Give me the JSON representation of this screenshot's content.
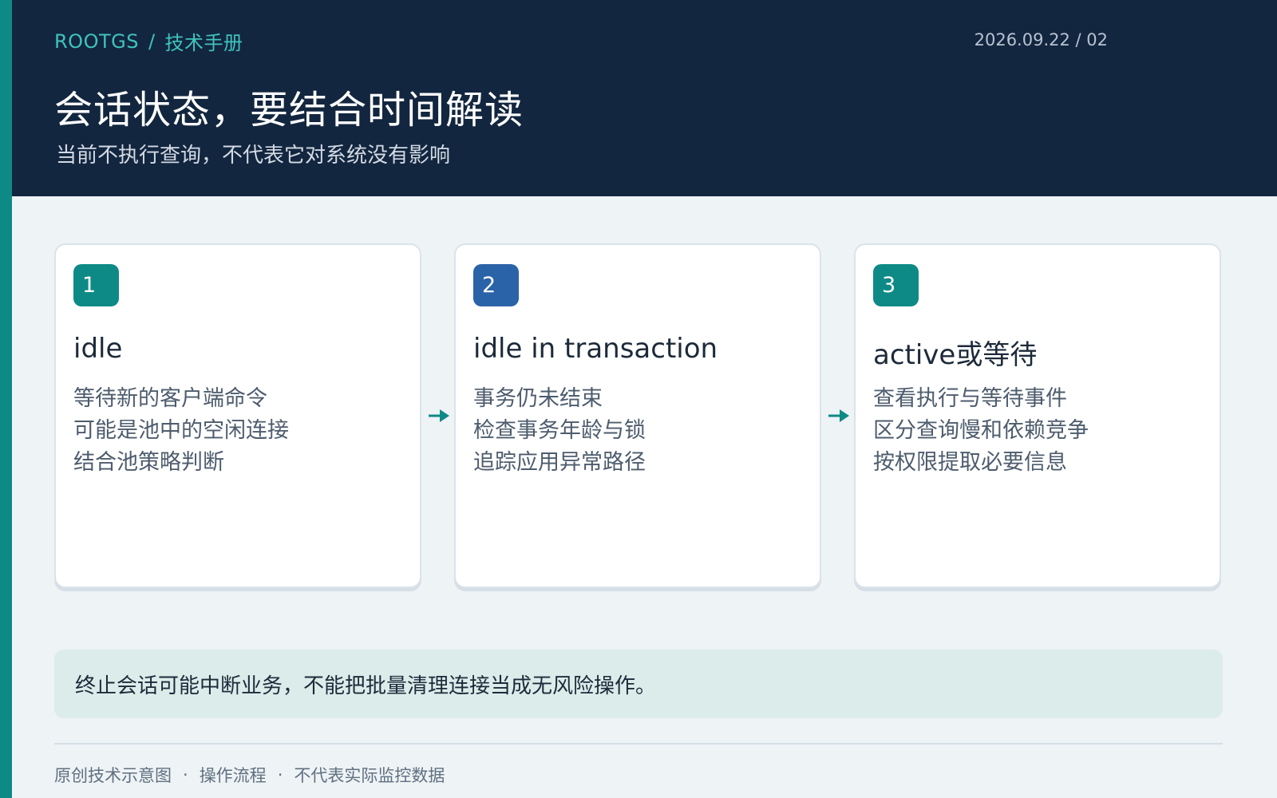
{
  "colors": {
    "accent": "#0e8a86",
    "header_bg": "#13263f",
    "badge_teal": "#0e8a86",
    "badge_blue": "#2b63a8",
    "notice_bg": "#dcecea"
  },
  "header": {
    "brand": "ROOTGS",
    "separator": "/",
    "section": "技术手册",
    "meta": "2026.09.22 / 02",
    "title": "会话状态，要结合时间解读",
    "subtitle": "当前不执行查询，不代表它对系统没有影响"
  },
  "cards": [
    {
      "step": "1",
      "badge_color": "#0e8a86",
      "title": "idle",
      "lines": [
        "等待新的客户端命令",
        "可能是池中的空闲连接",
        "结合池策略判断"
      ]
    },
    {
      "step": "2",
      "badge_color": "#2b63a8",
      "title": "idle in transaction",
      "lines": [
        "事务仍未结束",
        "检查事务年龄与锁",
        "追踪应用异常路径"
      ]
    },
    {
      "step": "3",
      "badge_color": "#0e8a86",
      "title": "active或等待",
      "lines": [
        "查看执行与等待事件",
        "区分查询慢和依赖竞争",
        "按权限提取必要信息"
      ]
    }
  ],
  "arrows": [
    {
      "icon": "arrow-right-icon",
      "color": "#0e8a86"
    },
    {
      "icon": "arrow-right-icon",
      "color": "#0e8a86"
    }
  ],
  "notice": {
    "text": "终止会话可能中断业务，不能把批量清理连接当成无风险操作。"
  },
  "footer": {
    "items": [
      "原创技术示意图",
      "操作流程",
      "不代表实际监控数据"
    ],
    "separator": "·"
  }
}
